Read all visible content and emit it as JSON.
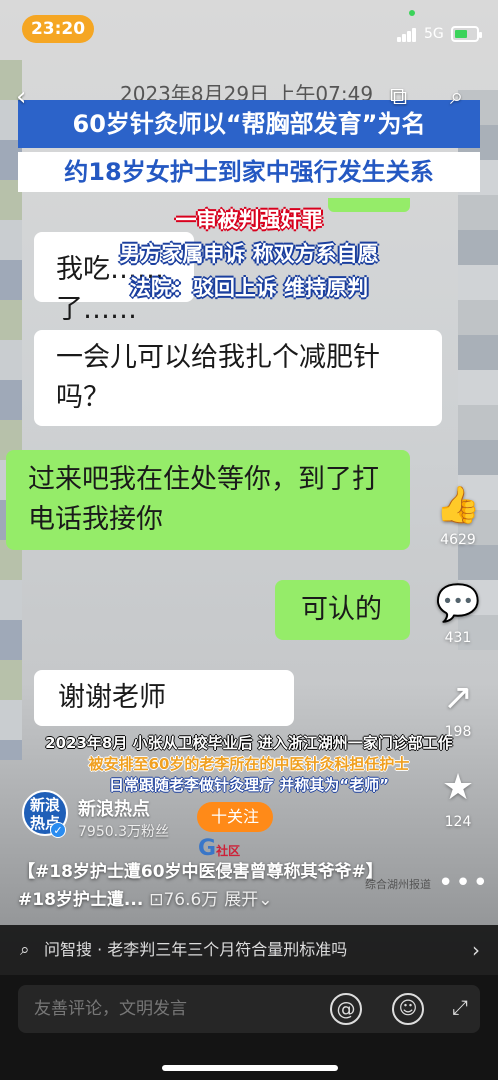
{
  "status": {
    "time": "23:20",
    "network": "5G"
  },
  "video": {
    "date_stamp": "2023年8月29日 上午07:49",
    "banner_line1": "60岁针灸师以“帮胸部发育”为名",
    "banner_line2": "约18岁女护士到家中强行发生关系",
    "subtitle_red": "一审被判强奸罪",
    "subtitle_blue1": "男方家属申诉 称双方系自愿",
    "subtitle_blue2": "法院：驳回上诉 维持原判",
    "chat": {
      "top_fragment": "我吃……了……",
      "msg1": "一会儿可以给我扎个减肥针吗？",
      "msg2": "过来吧我在住处等你，到了打电话我接你",
      "msg3": "可认的",
      "msg4": "谢谢老师"
    },
    "caption1": "2023年8月 小张从卫校毕业后 进入浙江湖州一家门诊部工作",
    "caption2": "被安排至60岁的老李所在的中医针灸科担任护士",
    "caption3": "日常跟随老李做针灸理疗 并称其为“老师”",
    "watermark": "综合湖州报道"
  },
  "rail": {
    "likes": "4629",
    "comments": "431",
    "shares": "198",
    "favorites": "124"
  },
  "author": {
    "avatar_text": "新浪热点",
    "name": "新浪热点",
    "fans": "7950.3万粉丝",
    "follow_label": "十关注"
  },
  "description": {
    "text": "【#18岁护士遭60岁中医侵害曾尊称其爷爷#】#18岁护士遭...",
    "views": "⊡76.6万",
    "expand": "展开⌄"
  },
  "search": {
    "text": "问智搜 · 老李判三年三个月符合量刑标准吗"
  },
  "comment_input": {
    "placeholder": "友善评论，文明发言"
  }
}
